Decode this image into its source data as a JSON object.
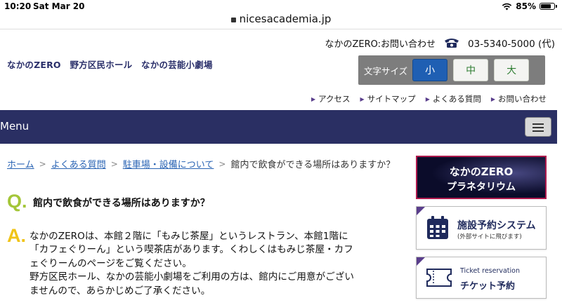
{
  "status": {
    "time": "10:20",
    "date": "Sat Mar 20",
    "battery": "85%",
    "battery_level": 0.85
  },
  "url": "nicesacademia.jp",
  "header": {
    "contact_label": "なかのZERO:お問い合わせ",
    "tel": "03-5340-5000 (代)",
    "site_title": "なかのZERO　野方区民ホール　なかの芸能小劇場",
    "fontsize": {
      "label": "文字サイズ",
      "options": [
        "小",
        "中",
        "大"
      ],
      "selected": "小"
    },
    "util_links": [
      "アクセス",
      "サイトマップ",
      "よくある質問",
      "お問い合わせ"
    ]
  },
  "menu": {
    "label": "Menu"
  },
  "breadcrumb": {
    "items": [
      "ホーム",
      "よくある質問",
      "駐車場・設備について"
    ],
    "current": "館内で飲食ができる場所はありますか？"
  },
  "qa": {
    "q_mark": "Q.",
    "question": "館内で飲食ができる場所はありますか？",
    "a_mark": "A.",
    "answer_lines": [
      "なかのZEROは、本館２階に「もみじ茶屋」というレストラン、本館1階に",
      "「カフェぐりーん」という喫茶店があります。くわしくはもみじ茶屋・カフ",
      "ェぐりーんのページをご覧ください。",
      "野方区民ホール、なかの芸能小劇場をご利用の方は、館内にご用意がござい",
      "ませんので、あらかじめご了承ください。"
    ]
  },
  "sidebar": {
    "planetarium": {
      "line1": "なかのZERO",
      "line2": "プラネタリウム"
    },
    "reserve": {
      "title": "施設予約システム",
      "note": "(外部サイトに飛びます)"
    },
    "ticket": {
      "en": "Ticket reservation",
      "jp": "チケット予約"
    }
  }
}
